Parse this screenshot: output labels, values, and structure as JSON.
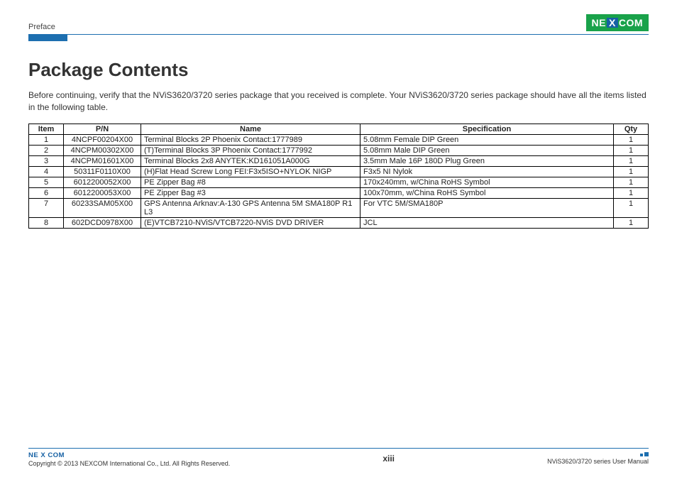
{
  "header": {
    "section": "Preface",
    "logo_text_pre": "NE",
    "logo_text_x": "X",
    "logo_text_post": "COM"
  },
  "title": "Package Contents",
  "intro": "Before continuing, verify that the NViS3620/3720 series package that you received is complete. Your NViS3620/3720 series package should have all the items listed in the following table.",
  "table": {
    "headers": {
      "item": "Item",
      "pn": "P/N",
      "name": "Name",
      "spec": "Specification",
      "qty": "Qty"
    },
    "rows": [
      {
        "item": "1",
        "pn": "4NCPF00204X00",
        "name": "Terminal Blocks 2P Phoenix Contact:1777989",
        "spec": "5.08mm Female DIP Green",
        "qty": "1"
      },
      {
        "item": "2",
        "pn": "4NCPM00302X00",
        "name": "(T)Terminal Blocks 3P Phoenix Contact:1777992",
        "spec": "5.08mm Male DIP Green",
        "qty": "1"
      },
      {
        "item": "3",
        "pn": "4NCPM01601X00",
        "name": "Terminal Blocks 2x8 ANYTEK:KD161051A000G",
        "spec": "3.5mm Male 16P 180D Plug Green",
        "qty": "1"
      },
      {
        "item": "4",
        "pn": "50311F0110X00",
        "name": "(H)Flat Head Screw Long FEI:F3x5ISO+NYLOK NIGP",
        "spec": "F3x5 NI Nylok",
        "qty": "1"
      },
      {
        "item": "5",
        "pn": "6012200052X00",
        "name": "PE Zipper Bag #8",
        "spec": "170x240mm, w/China RoHS Symbol",
        "qty": "1"
      },
      {
        "item": "6",
        "pn": "6012200053X00",
        "name": "PE Zipper Bag #3",
        "spec": "100x70mm, w/China RoHS Symbol",
        "qty": "1"
      },
      {
        "item": "7",
        "pn": "60233SAM05X00",
        "name": "GPS Antenna Arknav:A-130 GPS Antenna 5M SMA180P R1 L3",
        "spec": "For VTC 5M/SMA180P",
        "qty": "1"
      },
      {
        "item": "8",
        "pn": "602DCD0978X00",
        "name": "(E)VTCB7210-NViS/VTCB7220-NViS DVD DRIVER",
        "spec": "JCL",
        "qty": "1"
      }
    ]
  },
  "footer": {
    "copyright": "Copyright © 2013 NEXCOM International Co., Ltd. All Rights Reserved.",
    "page_num": "xiii",
    "doc_title": "NViS3620/3720 series User Manual"
  }
}
